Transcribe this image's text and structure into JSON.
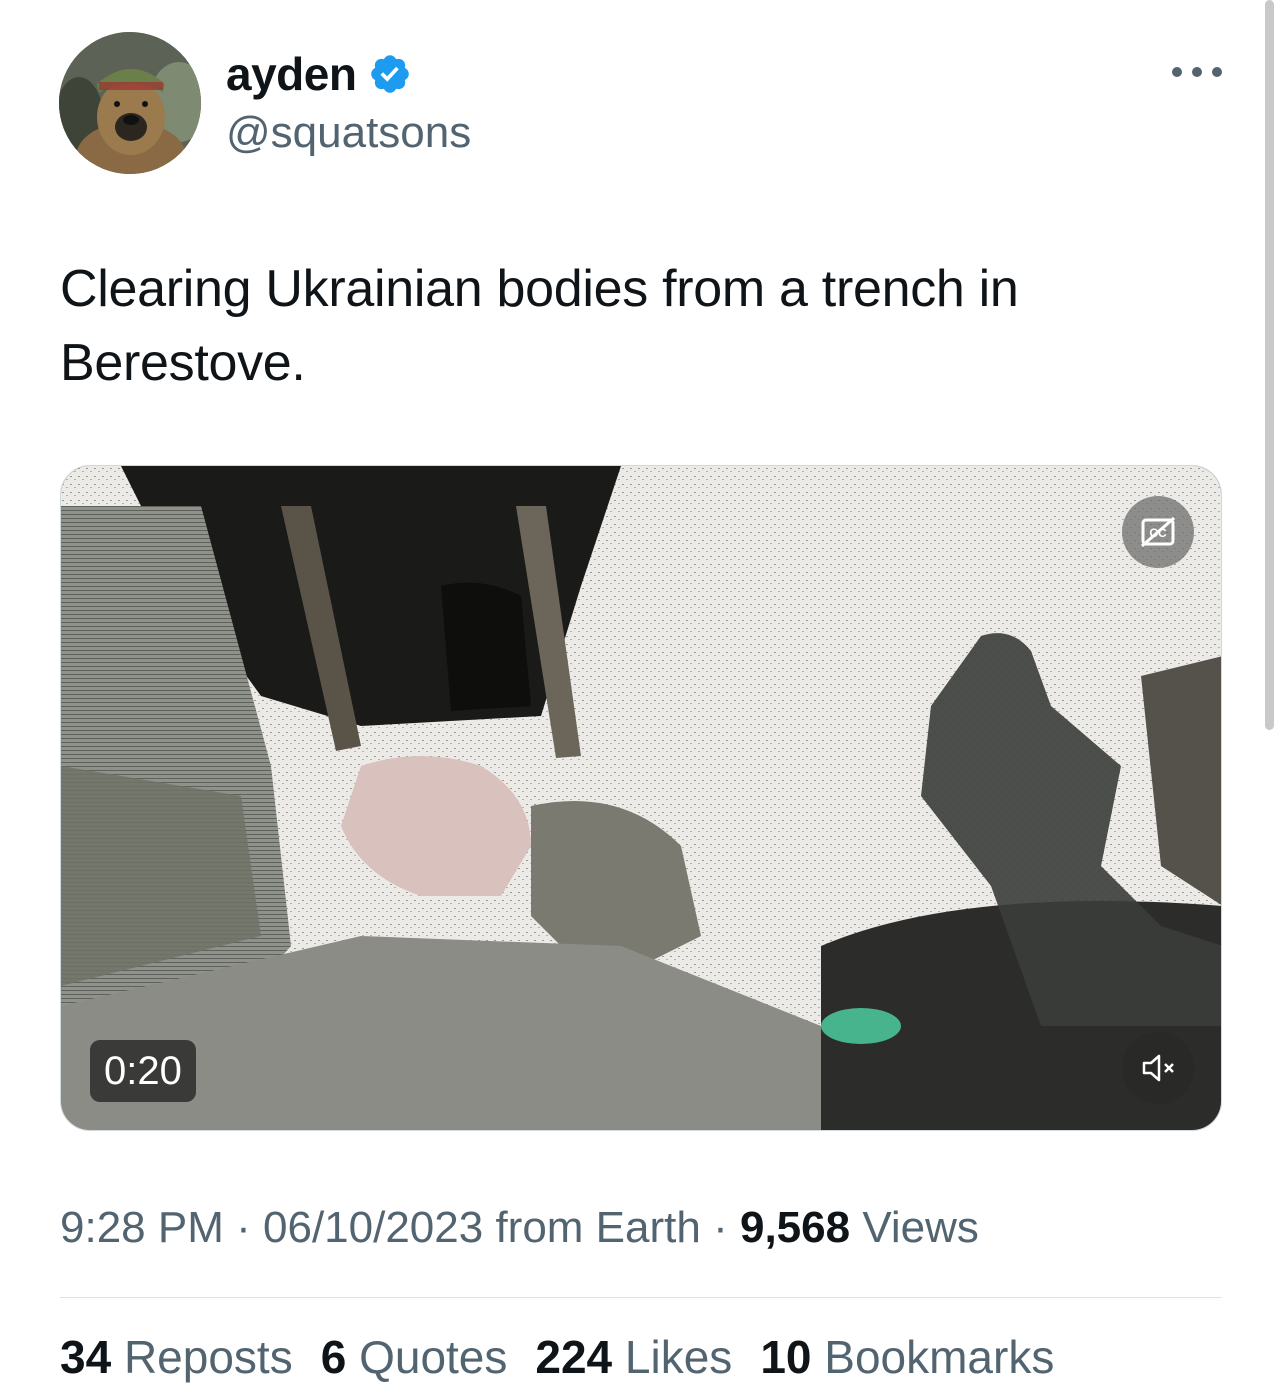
{
  "author": {
    "display_name": "ayden",
    "handle": "@squatsons",
    "verified": true,
    "avatar_icon": "dog-in-helmet-avatar"
  },
  "tweet": {
    "text": "Clearing Ukrainian bodies from a trench in Berestove."
  },
  "media": {
    "duration": "0:20",
    "cc_icon": "closed-captions-off-icon",
    "mute_icon": "speaker-muted-icon"
  },
  "meta": {
    "time": "9:28 PM",
    "separator": "·",
    "date": "06/10/2023",
    "source": "from Earth",
    "views_count": "9,568",
    "views_label": "Views"
  },
  "stats": {
    "reposts_count": "34",
    "reposts_label": "Reposts",
    "quotes_count": "6",
    "quotes_label": "Quotes",
    "likes_count": "224",
    "likes_label": "Likes",
    "bookmarks_count": "10",
    "bookmarks_label": "Bookmarks"
  },
  "colors": {
    "text_primary": "#0f1419",
    "text_secondary": "#536471",
    "verified_blue": "#1d9bf0"
  }
}
